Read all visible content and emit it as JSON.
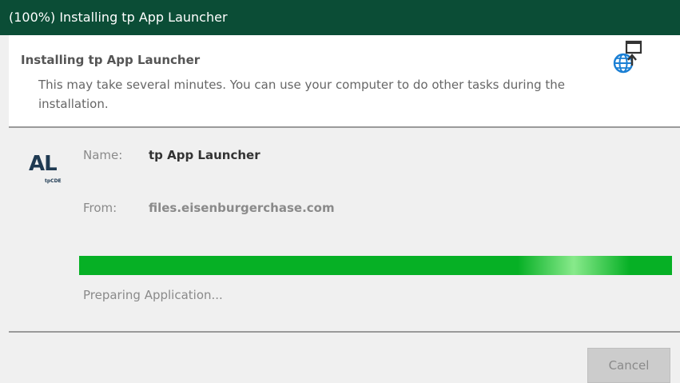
{
  "window": {
    "title": "(100%) Installing tp App Launcher"
  },
  "header": {
    "title": "Installing tp App Launcher",
    "description": "This may take several minutes. You can use your computer to do other tasks during the installation.",
    "icon": "globe-install-icon"
  },
  "app": {
    "logo_text": "AL",
    "logo_subtext": "tpCDE",
    "name_label": "Name:",
    "name_value": "tp App Launcher",
    "from_label": "From:",
    "from_value": "files.eisenburgerchase.com"
  },
  "progress": {
    "percent": 100,
    "status": "Preparing Application..."
  },
  "footer": {
    "cancel_label": "Cancel"
  },
  "colors": {
    "title_bar": "#0b4d36",
    "progress_fill": "#06b025",
    "logo": "#1f3a52",
    "globe": "#1a7fd4"
  }
}
